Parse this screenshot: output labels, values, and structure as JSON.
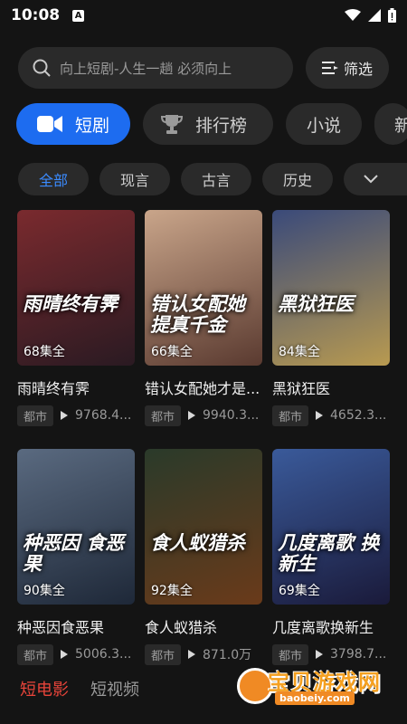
{
  "status_bar": {
    "time": "10:08",
    "notification_letter": "A"
  },
  "search": {
    "placeholder": "向上短剧-人生一趟 必须向上",
    "filter_label": "筛选"
  },
  "category_tabs": [
    {
      "label": "短剧",
      "icon": "video-camera-icon",
      "active": true
    },
    {
      "label": "排行榜",
      "icon": "trophy-icon",
      "active": false
    },
    {
      "label": "小说",
      "active": false
    },
    {
      "label": "新",
      "active": false
    }
  ],
  "sub_tabs": [
    {
      "label": "全部",
      "active": true
    },
    {
      "label": "现言",
      "active": false
    },
    {
      "label": "古言",
      "active": false
    },
    {
      "label": "历史",
      "active": false
    },
    {
      "label": "",
      "active": false
    }
  ],
  "dramas": [
    {
      "poster_title": "雨晴终有霁",
      "episodes": "68集全",
      "title": "雨晴终有霁",
      "genre": "都市",
      "views": "9768.4...",
      "poster_color_a": "#7a2a2e",
      "poster_color_b": "#2a1a22"
    },
    {
      "poster_title": "错认女配她 提真千金",
      "episodes": "66集全",
      "title": "错认女配她才是...",
      "genre": "都市",
      "views": "9940.3...",
      "poster_color_a": "#c9a58a",
      "poster_color_b": "#5a3a30"
    },
    {
      "poster_title": "黑狱狂医",
      "episodes": "84集全",
      "title": "黑狱狂医",
      "genre": "都市",
      "views": "4652.3...",
      "poster_color_a": "#3a4a7a",
      "poster_color_b": "#b89a50"
    },
    {
      "poster_title": "种恶因 食恶果",
      "episodes": "90集全",
      "title": "种恶因食恶果",
      "genre": "都市",
      "views": "5006.3...",
      "poster_color_a": "#5a6a80",
      "poster_color_b": "#1e2838"
    },
    {
      "poster_title": "食人蚁猎杀",
      "episodes": "92集全",
      "title": "食人蚁猎杀",
      "genre": "都市",
      "views": "871.0万",
      "poster_color_a": "#2a3a2a",
      "poster_color_b": "#6a3a1a"
    },
    {
      "poster_title": "几度离歌 换新生",
      "episodes": "69集全",
      "title": "几度离歌换新生",
      "genre": "都市",
      "views": "3798.7...",
      "poster_color_a": "#3a5a9a",
      "poster_color_b": "#1a1a3a"
    }
  ],
  "bottom_tabs": [
    {
      "label": "短电影",
      "active": true
    },
    {
      "label": "短视频",
      "active": false
    }
  ],
  "watermark": {
    "text": "宝贝游戏网",
    "url": "baobeiy.com"
  },
  "colors": {
    "accent": "#1d6cf0",
    "active_bottom": "#e8443a",
    "background": "#141414"
  }
}
